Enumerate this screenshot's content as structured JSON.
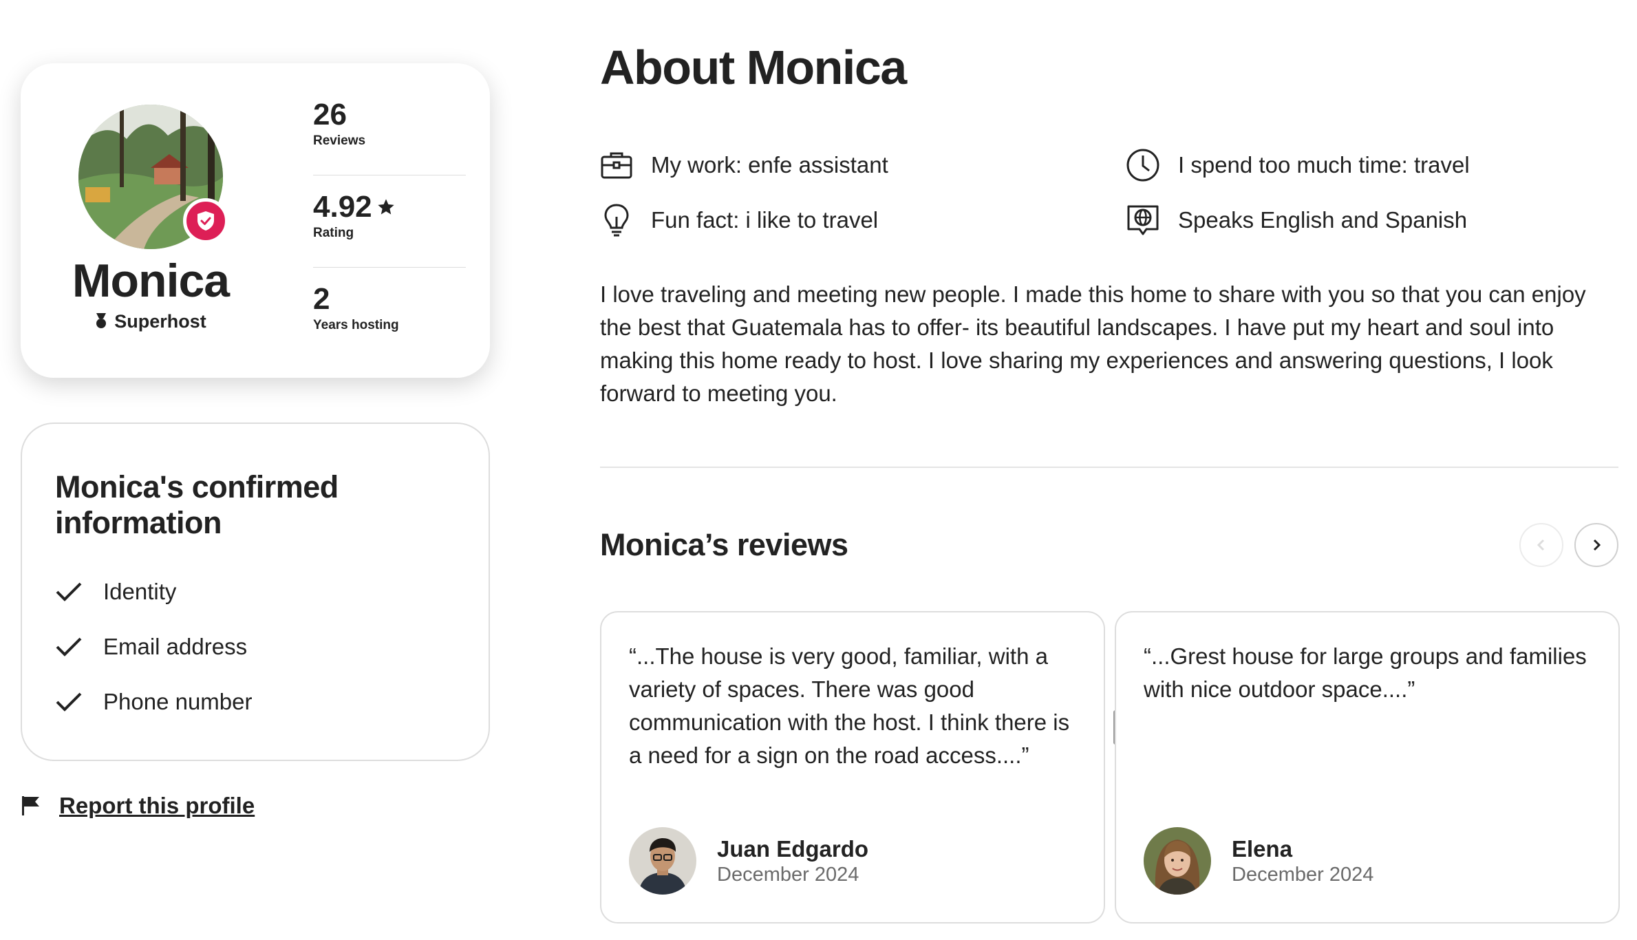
{
  "profile": {
    "name": "Monica",
    "badge_label": "Superhost",
    "stats": [
      {
        "value": "26",
        "label": "Reviews"
      },
      {
        "value": "4.92",
        "label": "Rating"
      },
      {
        "value": "2",
        "label": "Years hosting"
      }
    ]
  },
  "confirmed": {
    "title": "Monica's confirmed information",
    "items": [
      "Identity",
      "Email address",
      "Phone number"
    ]
  },
  "report_label": "Report this profile",
  "about": {
    "title": "About Monica",
    "details": [
      {
        "icon": "briefcase-icon",
        "text": "My work: enfe assistant"
      },
      {
        "icon": "clock-icon",
        "text": "I spend too much time: travel"
      },
      {
        "icon": "lightbulb-icon",
        "text": "Fun fact: i like to travel"
      },
      {
        "icon": "globe-speech-icon",
        "text": "Speaks English and Spanish"
      }
    ],
    "bio": "I love traveling and meeting new people. I made this home to share with you so that you can enjoy the best that Guatemala has to offer- its beautiful landscapes. I have put my heart and soul into making this home ready to host. I love sharing my experiences and answering questions, I look forward to meeting you."
  },
  "reviews": {
    "title": "Monica’s reviews",
    "items": [
      {
        "text": "“...The house is very good, familiar, with a variety of spaces. There was good communication with the host. I think there is a need for a sign on the road access....”",
        "name": "Juan Edgardo",
        "date": "December 2024"
      },
      {
        "text": "“...Grest house for large groups and families with nice outdoor space....”",
        "name": "Elena",
        "date": "December 2024"
      }
    ]
  },
  "colors": {
    "accent": "#dd1f56",
    "text": "#222222",
    "muted": "#6a6a6a",
    "border": "#dddddd"
  }
}
